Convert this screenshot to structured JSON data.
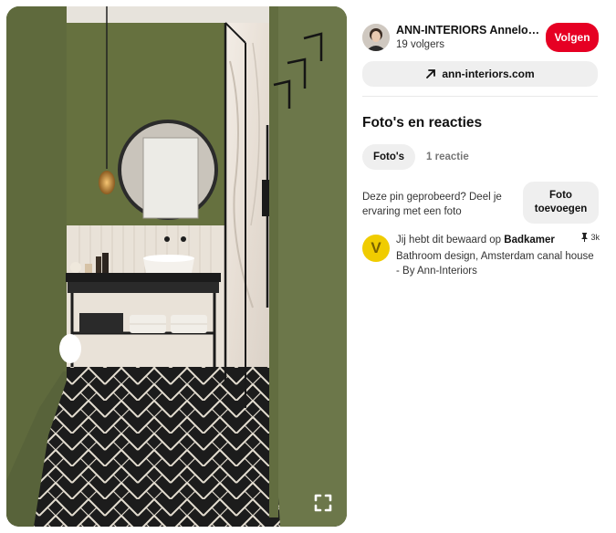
{
  "creator": {
    "name": "ANN-INTERIORS Anneloes ...",
    "followers": "19 volgers",
    "follow_label": "Volgen"
  },
  "website": {
    "label": "ann-interiors.com",
    "icon": "arrow-up-right-icon"
  },
  "comments_section": {
    "title": "Foto's en reacties",
    "tabs": [
      {
        "label": "Foto's",
        "active": true
      },
      {
        "label": "1 reactie",
        "active": false
      }
    ],
    "tried_prompt": "Deze pin geprobeerd? Deel je ervaring met een foto",
    "add_photo_label": "Foto\ntoevoegen"
  },
  "saved": {
    "avatar_letter": "V",
    "prefix": "Jij hebt dit bewaard op ",
    "board": "Badkamer",
    "pin_count": "3k",
    "description": "Bathroom design, Amsterdam canal house - By Ann-Interiors"
  },
  "colors": {
    "follow_red": "#e60023",
    "wall_green": "#6f7a4c",
    "board_yellow": "#f0cc00"
  }
}
